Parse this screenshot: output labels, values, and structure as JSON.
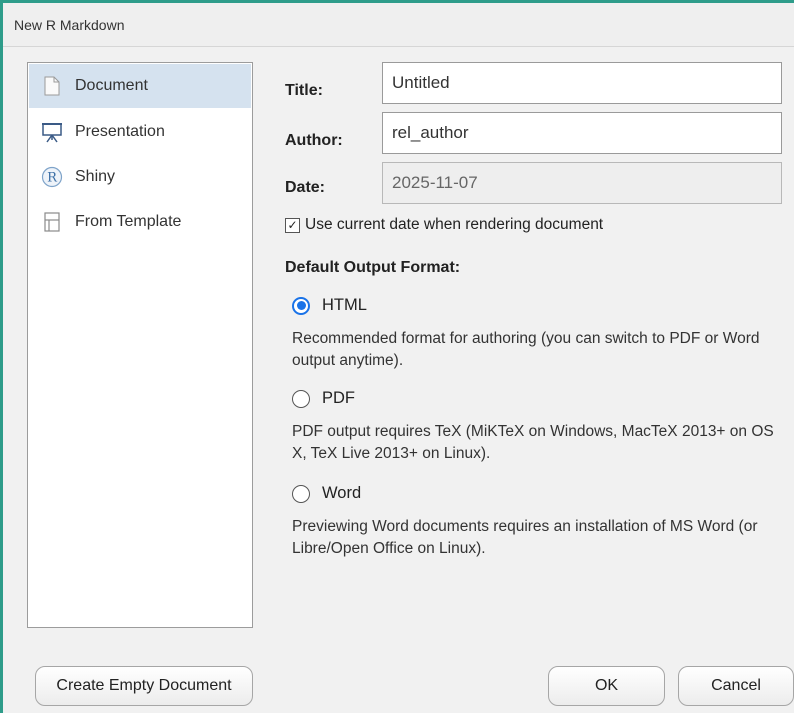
{
  "window": {
    "title": "New R Markdown"
  },
  "sidebar": {
    "items": [
      {
        "label": "Document",
        "icon": "document-icon",
        "selected": true
      },
      {
        "label": "Presentation",
        "icon": "presentation-icon",
        "selected": false
      },
      {
        "label": "Shiny",
        "icon": "shiny-r-icon",
        "selected": false
      },
      {
        "label": "From Template",
        "icon": "template-icon",
        "selected": false
      }
    ]
  },
  "form": {
    "title_label": "Title:",
    "title_value": "Untitled",
    "author_label": "Author:",
    "author_value": "rel_author",
    "date_label": "Date:",
    "date_value": "2025-11-07",
    "use_current_date_label": "Use current date when rendering document",
    "use_current_date_checked": true,
    "output_format_heading": "Default Output Format:",
    "formats": [
      {
        "label": "HTML",
        "description": "Recommended format for authoring (you can switch to PDF or Word output anytime).",
        "selected": true
      },
      {
        "label": "PDF",
        "description": "PDF output requires TeX (MiKTeX on Windows, MacTeX 2013+ on OS X, TeX Live 2013+ on Linux).",
        "selected": false
      },
      {
        "label": "Word",
        "description": "Previewing Word documents requires an installation of MS Word (or Libre/Open Office on Linux).",
        "selected": false
      }
    ]
  },
  "buttons": {
    "create_empty": "Create Empty Document",
    "ok": "OK",
    "cancel": "Cancel"
  },
  "colors": {
    "accent_border": "#2e9c8a",
    "selection": "#d5e2ef",
    "radio_active": "#1a73e8"
  }
}
